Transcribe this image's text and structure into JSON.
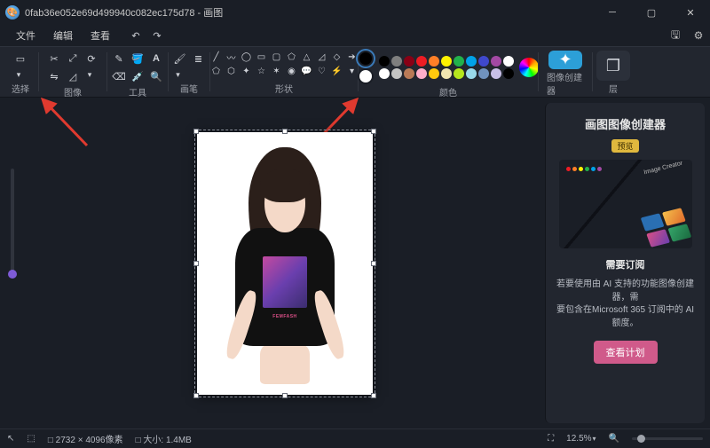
{
  "title": "0fab36e052e69d499940c082ec175d78 - 画图",
  "menu": {
    "file": "文件",
    "edit": "编辑",
    "view": "查看"
  },
  "sections": {
    "select": "选择",
    "image": "图像",
    "tools": "工具",
    "brush": "画笔",
    "shapes": "形状",
    "color": "颜色",
    "creator": "图像创建器",
    "layer": "层"
  },
  "palette_row1": [
    "#000000",
    "#7f7f7f",
    "#880015",
    "#ed1c24",
    "#ff7f27",
    "#fff200",
    "#22b14c",
    "#00a2e8",
    "#3f48cc",
    "#a349a4",
    "#ffffff"
  ],
  "palette_row2": [
    "#ffffff",
    "#c3c3c3",
    "#b97a57",
    "#ffaec9",
    "#ffc90e",
    "#efe4b0",
    "#b5e61d",
    "#99d9ea",
    "#7092be",
    "#c8bfe7",
    "#000000"
  ],
  "current_colors": {
    "primary": "#000000",
    "secondary": "#ffffff"
  },
  "panel": {
    "title": "画图图像创建器",
    "badge": "预览",
    "imglabel": "Image Creator",
    "subtitle": "需要订阅",
    "desc1": "若要使用由 AI 支持的功能图像创建器，需",
    "desc2": "要包含在Microsoft 365 订阅中的 AI 额度。",
    "cta": "查看计划",
    "preview_pal": [
      "#ed1c24",
      "#ff7f27",
      "#fff200",
      "#22b14c",
      "#00a2e8",
      "#a349a4"
    ],
    "thumbs": [
      "#2a6fb3",
      "linear-gradient(135deg,#f5c14b,#e06a2b)",
      "linear-gradient(135deg,#d94f86,#6a3fae)",
      "linear-gradient(135deg,#35a56a,#1a6b3f)"
    ]
  },
  "artboard": {
    "print_logo": "FEMFASH"
  },
  "status": {
    "dims_icon": "□",
    "dims": "2732 × 4096像素",
    "size_icon": "□",
    "size_label": "大小:",
    "size": "1.4MB",
    "zoom": "12.5%"
  }
}
